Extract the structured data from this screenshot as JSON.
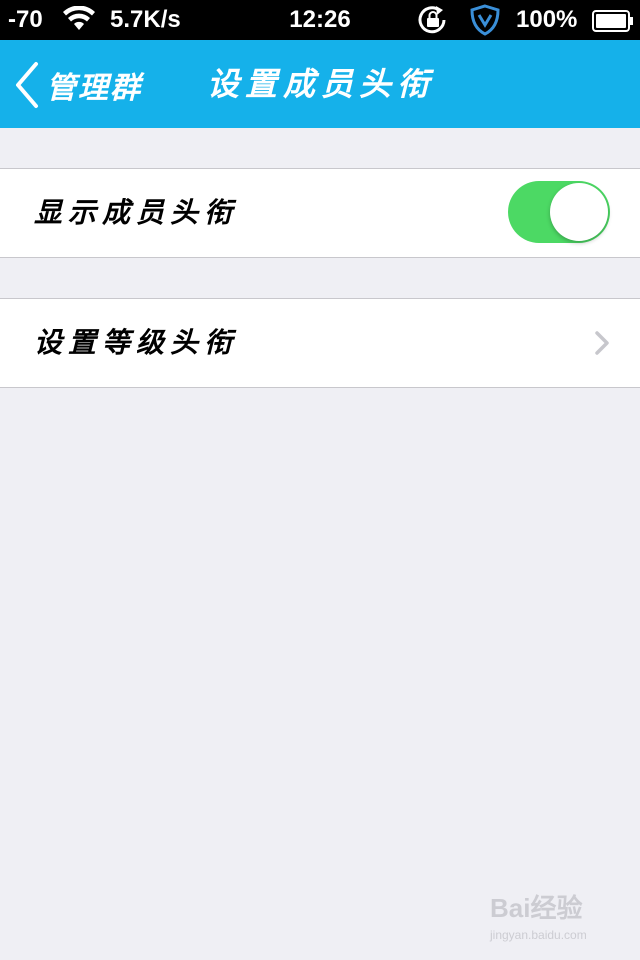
{
  "status_bar": {
    "signal": "-70",
    "speed": "5.7K/s",
    "time": "12:26",
    "battery": "100%"
  },
  "nav": {
    "back_label": "管理群",
    "title": "设置成员头衔"
  },
  "settings": {
    "show_titles": {
      "label": "显示成员头衔",
      "enabled": true
    },
    "level_titles": {
      "label": "设置等级头衔"
    }
  },
  "watermark": {
    "brand": "Bai经验",
    "sub": "jingyan.baidu.com"
  },
  "colors": {
    "nav_bg": "#15b1ea",
    "toggle_on": "#4cd964",
    "page_bg": "#efeff4"
  }
}
